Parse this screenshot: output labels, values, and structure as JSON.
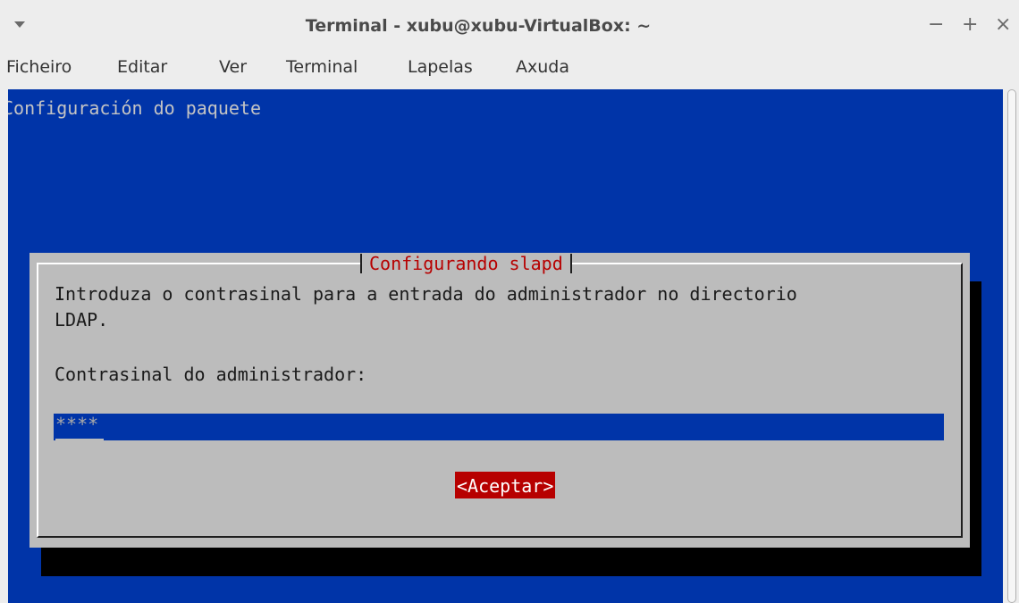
{
  "window": {
    "title": "Terminal - xubu@xubu-VirtualBox: ~",
    "controls": {
      "minimize": "−",
      "maximize": "+",
      "close": "×"
    }
  },
  "menubar": {
    "items": [
      {
        "label": "Ficheiro"
      },
      {
        "label": "Editar"
      },
      {
        "label": "Ver"
      },
      {
        "label": "Terminal"
      },
      {
        "label": "Lapelas"
      },
      {
        "label": "Axuda"
      }
    ]
  },
  "terminal": {
    "header": "Configuración do paquete",
    "background_color": "#0034a8"
  },
  "dialog": {
    "title": "Configurando slapd",
    "message_line1": "Introduza o contrasinal para a entrada do administrador no directorio",
    "message_line2": "LDAP.",
    "field_label": "Contrasinal do administrador:",
    "password_value": "****",
    "accept_button": "<Aceptar>",
    "accent_color": "#b70000"
  }
}
